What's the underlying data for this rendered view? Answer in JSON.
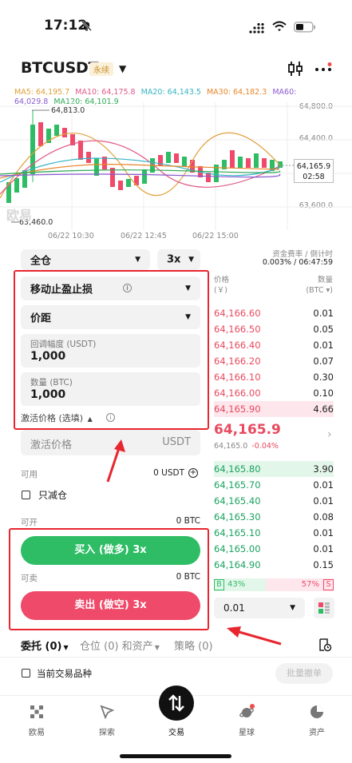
{
  "status_bar": {
    "time": "17:12"
  },
  "header": {
    "pair": "BTCUSDT",
    "badge": "永续"
  },
  "ma": {
    "ma5": "MA5: 64,195.7",
    "ma10": "MA10: 64,175.8",
    "ma20": "MA20: 64,143.5",
    "ma30": "MA30: 64,182.3",
    "ma60": "MA60:",
    "ma60_val": "64,029.8",
    "ma120": "MA120: 64,101.9",
    "colors": {
      "ma5": "#e0a03a",
      "ma10": "#e05a8a",
      "ma20": "#35b4c4",
      "ma30": "#e8862c",
      "ma60": "#8a5cd0",
      "ma120": "#2eaa55"
    }
  },
  "chart": {
    "y_labels": [
      "64,800.0",
      "64,400.0",
      "63,600.0"
    ],
    "x_labels": [
      "06/22 10:30",
      "06/22 12:45",
      "06/22 15:00"
    ],
    "high_label": "64,813.0",
    "low_label": "63,460.0",
    "current_price": "64,165.9",
    "countdown": "02:58",
    "watermark": "欧易"
  },
  "funding": {
    "title": "资金费率 / 倒计时",
    "value": "0.003% / 06:47:59"
  },
  "order_form": {
    "margin_mode": "全仓",
    "leverage": "3x",
    "order_type": "移动止盈止损",
    "callback_type": "价距",
    "callback_label": "回调幅度 (USDT)",
    "callback_value": "1,000",
    "qty_label": "数量 (BTC)",
    "qty_value": "1,000",
    "activation_label": "激活价格 (选填)",
    "activation_input_label": "激活价格",
    "activation_unit": "USDT",
    "available_label": "可用",
    "available_value": "0 USDT",
    "reduce_only": "只减仓",
    "can_open_label": "可开",
    "can_open_value": "0 BTC",
    "buy_label": "买入 (做多) 3x",
    "can_sell_label": "可卖",
    "can_sell_value": "0 BTC",
    "sell_label": "卖出 (做空) 3x"
  },
  "orderbook": {
    "col_price": "价格",
    "col_price_unit": "(￥)",
    "col_qty": "数量",
    "col_qty_unit": "(BTC ▾)",
    "asks": [
      {
        "price": "64,166.60",
        "qty": "0.01"
      },
      {
        "price": "64,166.50",
        "qty": "0.05"
      },
      {
        "price": "64,166.40",
        "qty": "0.01"
      },
      {
        "price": "64,166.20",
        "qty": "0.07"
      },
      {
        "price": "64,166.10",
        "qty": "0.30"
      },
      {
        "price": "64,166.00",
        "qty": "0.10"
      },
      {
        "price": "64,165.90",
        "qty": "4.66"
      }
    ],
    "last_price": "64,165.9",
    "last_sub": "64,165.0",
    "change": "-0.04%",
    "bids": [
      {
        "price": "64,165.80",
        "qty": "3.90"
      },
      {
        "price": "64,165.70",
        "qty": "0.01"
      },
      {
        "price": "64,165.40",
        "qty": "0.01"
      },
      {
        "price": "64,165.30",
        "qty": "0.08"
      },
      {
        "price": "64,165.10",
        "qty": "0.01"
      },
      {
        "price": "64,165.00",
        "qty": "0.01"
      },
      {
        "price": "64,164.90",
        "qty": "0.15"
      }
    ],
    "buy_ratio_label": "B",
    "buy_ratio": "43%",
    "sell_ratio": "57%",
    "sell_ratio_label": "S",
    "precision": "0.01"
  },
  "bottom_tabs": {
    "orders": "委托 (0)",
    "positions": "仓位 (0) 和资产",
    "strategy": "策略 (0)",
    "current_only": "当前交易品种",
    "batch_cancel": "批量撤单"
  },
  "nav": [
    {
      "label": "欧易"
    },
    {
      "label": "探索"
    },
    {
      "label": "交易"
    },
    {
      "label": "星球"
    },
    {
      "label": "资产"
    }
  ],
  "colors": {
    "buy": "#2ebd65",
    "sell": "#ef4a6a",
    "annotation": "#e8262f"
  }
}
